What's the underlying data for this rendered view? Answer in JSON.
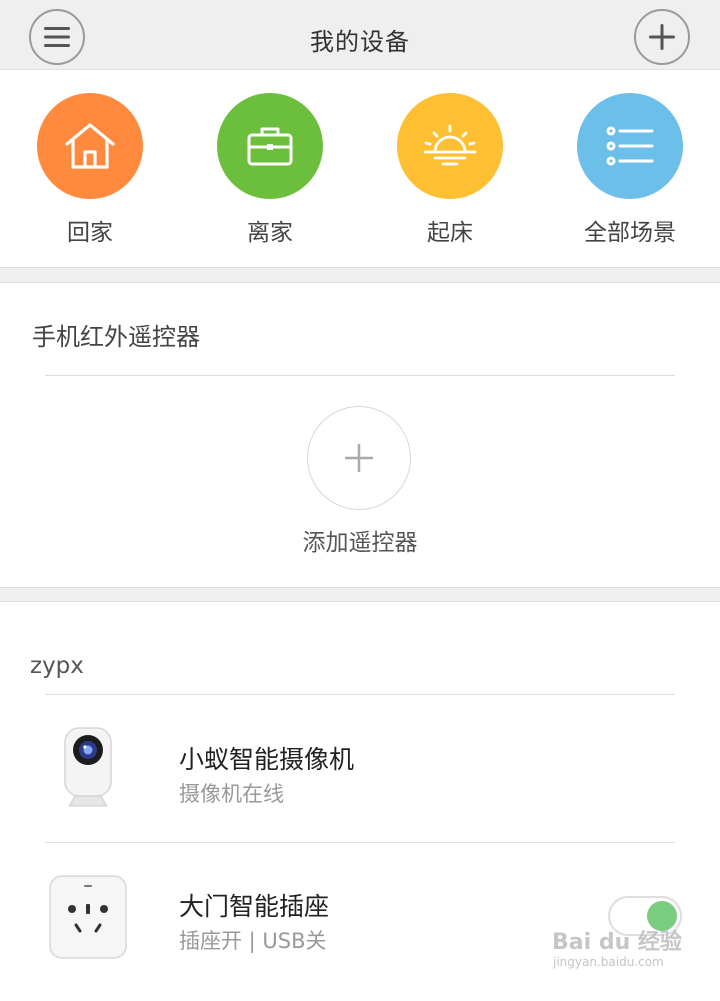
{
  "header": {
    "title": "我的设备",
    "menu_icon": "menu-icon",
    "add_icon": "plus-icon"
  },
  "scenes": [
    {
      "label": "回家",
      "icon": "home-icon",
      "color": "#ff8a3d"
    },
    {
      "label": "离家",
      "icon": "briefcase-icon",
      "color": "#6cbf3c"
    },
    {
      "label": "起床",
      "icon": "sunrise-icon",
      "color": "#ffbf33"
    },
    {
      "label": "全部场景",
      "icon": "list-icon",
      "color": "#6cbfe8"
    }
  ],
  "ir_remote": {
    "title": "手机红外遥控器",
    "add_label": "添加遥控器"
  },
  "device_group": {
    "name": "zypx",
    "devices": [
      {
        "name": "小蚁智能摄像机",
        "status": "摄像机在线",
        "icon": "camera-icon"
      },
      {
        "name": "大门智能插座",
        "status": "插座开 | USB关",
        "icon": "smart-plug-icon",
        "toggle_on": true
      }
    ]
  },
  "watermark": {
    "text": "Bai du 经验",
    "url": "jingyan.baidu.com"
  }
}
